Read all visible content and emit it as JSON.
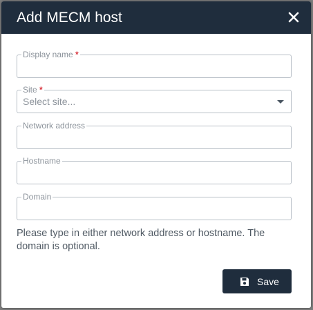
{
  "dialog": {
    "title": "Add MECM host",
    "close_icon": "close-icon"
  },
  "fields": {
    "display_name": {
      "label": "Display name",
      "required_mark": "*",
      "value": ""
    },
    "site": {
      "label": "Site",
      "required_mark": "*",
      "placeholder": "Select site...",
      "dropdown_icon": "chevron-down-icon"
    },
    "network_address": {
      "label": "Network address",
      "value": ""
    },
    "hostname": {
      "label": "Hostname",
      "value": ""
    },
    "domain": {
      "label": "Domain",
      "value": ""
    }
  },
  "hint": "Please type in either network address or hostname. The domain is optional.",
  "actions": {
    "save_label": "Save",
    "save_icon": "floppy-disk-icon"
  },
  "colors": {
    "header_bg": "#1f2d3d",
    "required": "#d8323c",
    "border": "#b7bec6"
  }
}
